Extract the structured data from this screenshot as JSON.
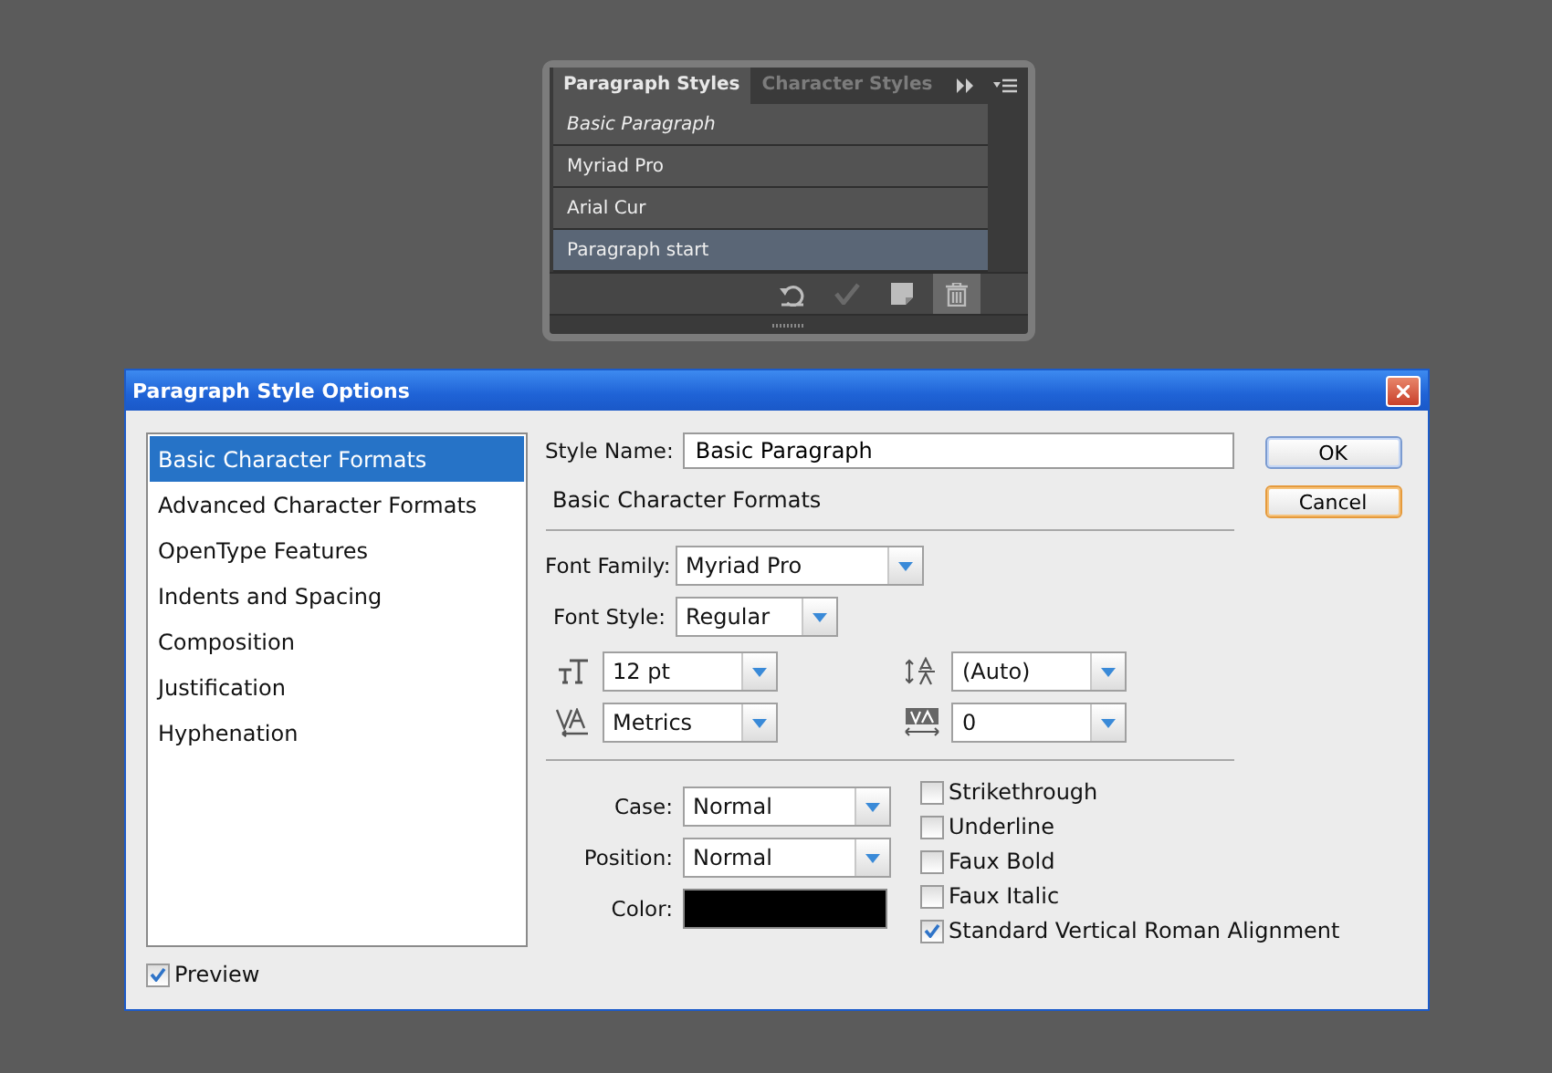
{
  "styles_panel": {
    "tabs": [
      {
        "label": "Paragraph Styles",
        "selected": true
      },
      {
        "label": "Character Styles",
        "selected": false
      }
    ],
    "items": [
      {
        "label": "Basic Paragraph",
        "default": true,
        "selected": false
      },
      {
        "label": "Myriad Pro",
        "default": false,
        "selected": false
      },
      {
        "label": "Arial Cur",
        "default": false,
        "selected": false
      },
      {
        "label": "Paragraph start",
        "default": false,
        "selected": true
      }
    ],
    "tools": [
      {
        "kind": "reset",
        "disabled": false,
        "selected": false
      },
      {
        "kind": "check",
        "disabled": true,
        "selected": false
      },
      {
        "kind": "new",
        "disabled": false,
        "selected": false
      },
      {
        "kind": "trash",
        "disabled": false,
        "selected": true
      }
    ]
  },
  "dialog": {
    "title": "Paragraph Style Options",
    "categories": [
      {
        "label": "Basic Character Formats",
        "selected": true
      },
      {
        "label": "Advanced Character Formats",
        "selected": false
      },
      {
        "label": "OpenType Features",
        "selected": false
      },
      {
        "label": "Indents and Spacing",
        "selected": false
      },
      {
        "label": "Composition",
        "selected": false
      },
      {
        "label": "Justification",
        "selected": false
      },
      {
        "label": "Hyphenation",
        "selected": false
      }
    ],
    "preview": {
      "label": "Preview",
      "checked": true
    },
    "style_name": {
      "label": "Style Name:",
      "value": "Basic Paragraph"
    },
    "section_title": "Basic Character Formats",
    "font_family": {
      "label": "Font Family:",
      "value": "Myriad Pro"
    },
    "font_style": {
      "label": "Font Style:",
      "value": "Regular"
    },
    "metrics": [
      {
        "kind": "size",
        "value": "12 pt"
      },
      {
        "kind": "leading",
        "value": "(Auto)"
      },
      {
        "kind": "kerning",
        "value": "Metrics"
      },
      {
        "kind": "tracking",
        "value": "0"
      }
    ],
    "case": {
      "label": "Case:",
      "value": "Normal"
    },
    "position": {
      "label": "Position:",
      "value": "Normal"
    },
    "color": {
      "label": "Color:",
      "color": "#000000"
    },
    "options": [
      {
        "label": "Strikethrough",
        "checked": false
      },
      {
        "label": "Underline",
        "checked": false
      },
      {
        "label": "Faux Bold",
        "checked": false
      },
      {
        "label": "Faux Italic",
        "checked": false
      },
      {
        "label": "Standard Vertical Roman Alignment",
        "checked": true
      }
    ],
    "buttons": [
      {
        "label": "OK",
        "focused": false
      },
      {
        "label": "Cancel",
        "focused": true
      }
    ]
  }
}
